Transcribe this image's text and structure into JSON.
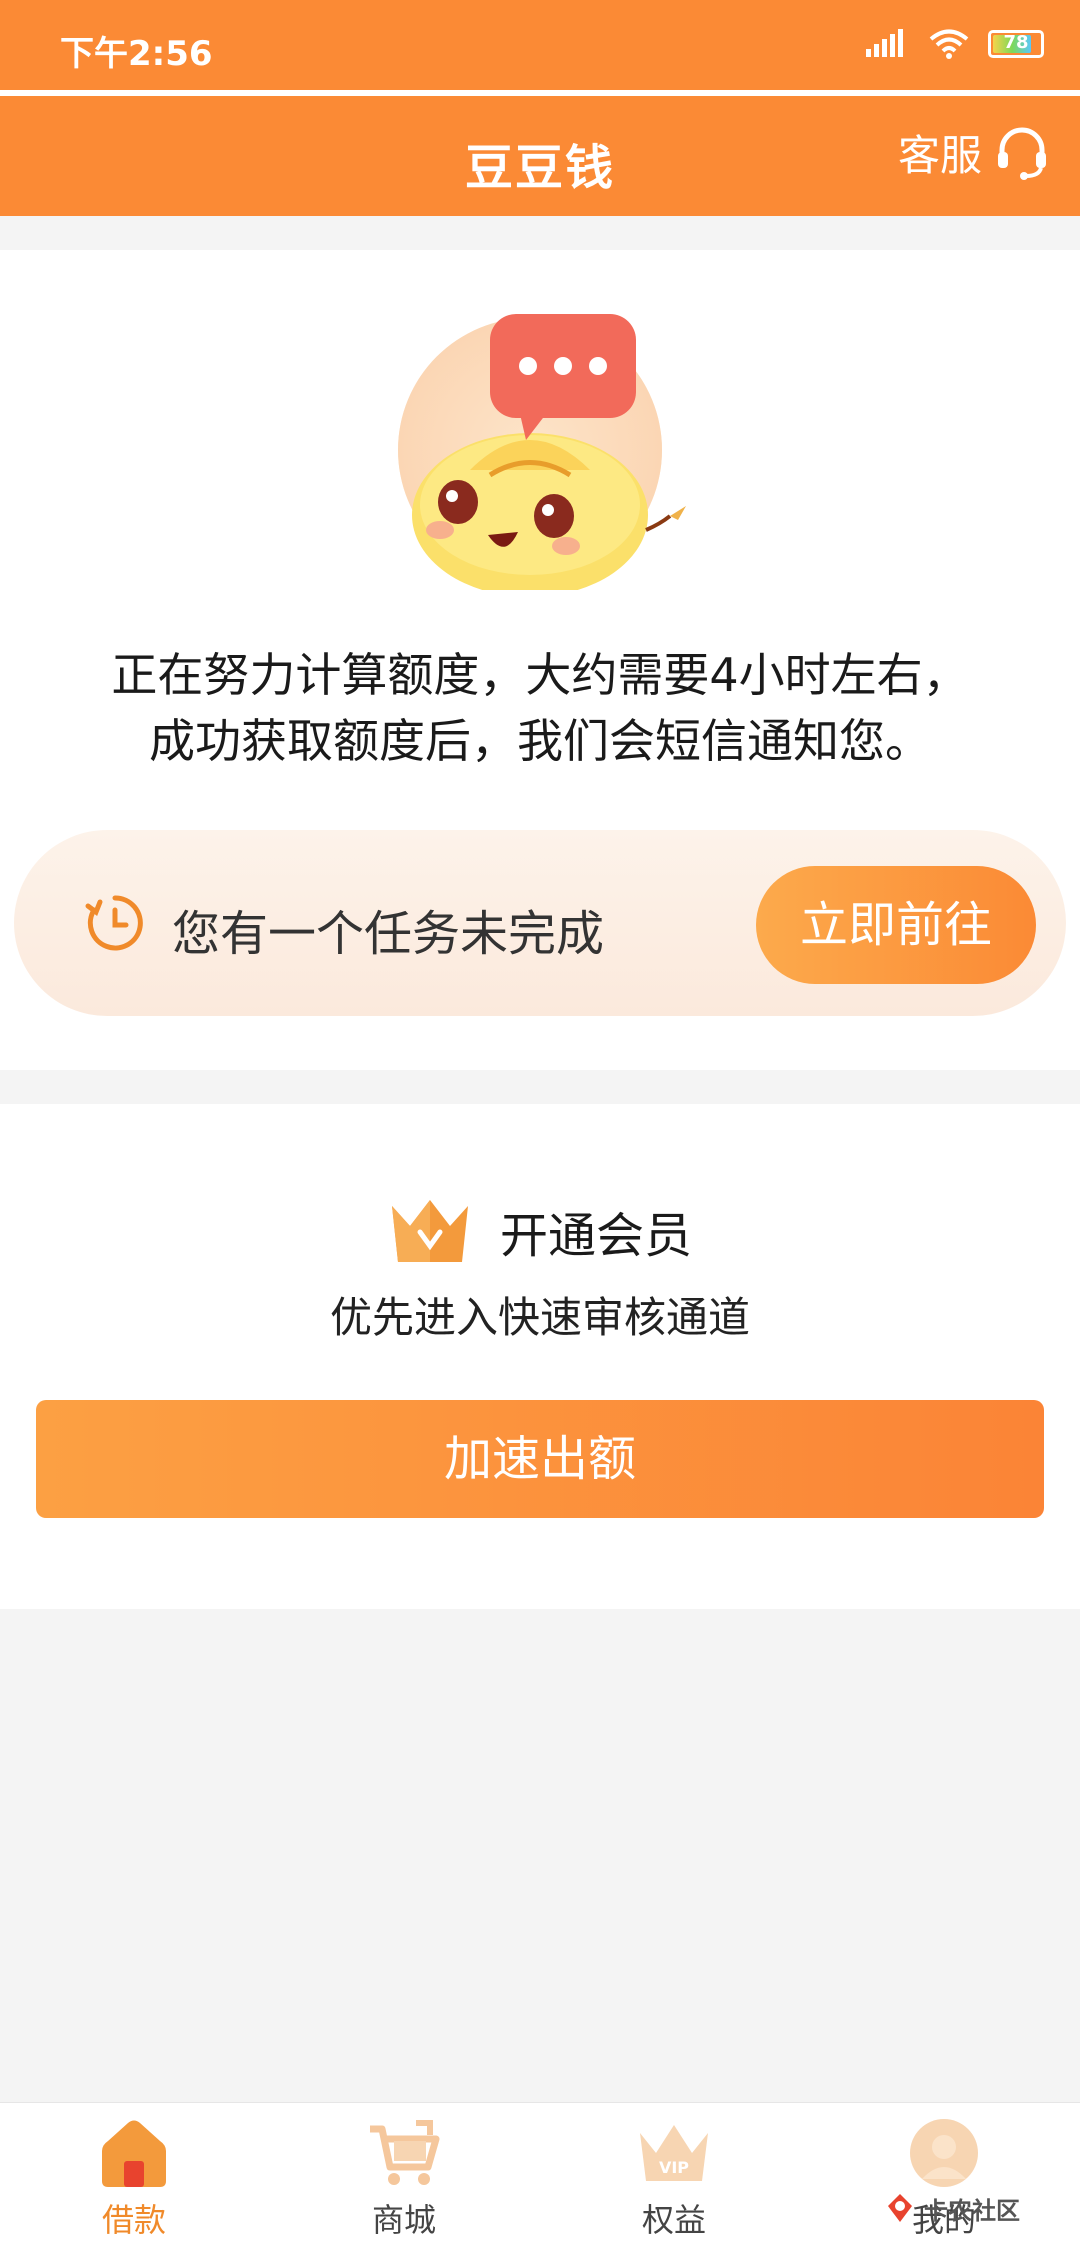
{
  "status_bar": {
    "time": "下午2:56",
    "battery": "78"
  },
  "nav": {
    "title": "豆豆钱",
    "service_label": "客服"
  },
  "main": {
    "calc_line1": "正在努力计算额度，大约需要4小时左右，",
    "calc_line2": "成功获取额度后，我们会短信通知您。",
    "task_text": "您有一个任务未完成",
    "go_button": "立即前往"
  },
  "vip": {
    "title": "开通会员",
    "subtitle": "优先进入快速审核通道",
    "button": "加速出额"
  },
  "tabs": [
    {
      "label": "借款",
      "icon": "home-icon",
      "active": true
    },
    {
      "label": "商城",
      "icon": "cart-icon",
      "active": false
    },
    {
      "label": "权益",
      "icon": "crown-vip-icon",
      "active": false
    },
    {
      "label": "我的",
      "icon": "avatar-icon",
      "active": false
    }
  ],
  "watermark": {
    "text": "卡农社区"
  },
  "colors": {
    "accent": "#fb8a35",
    "accent_light": "#fcaa4c",
    "tab_active": "#f08a2a"
  }
}
